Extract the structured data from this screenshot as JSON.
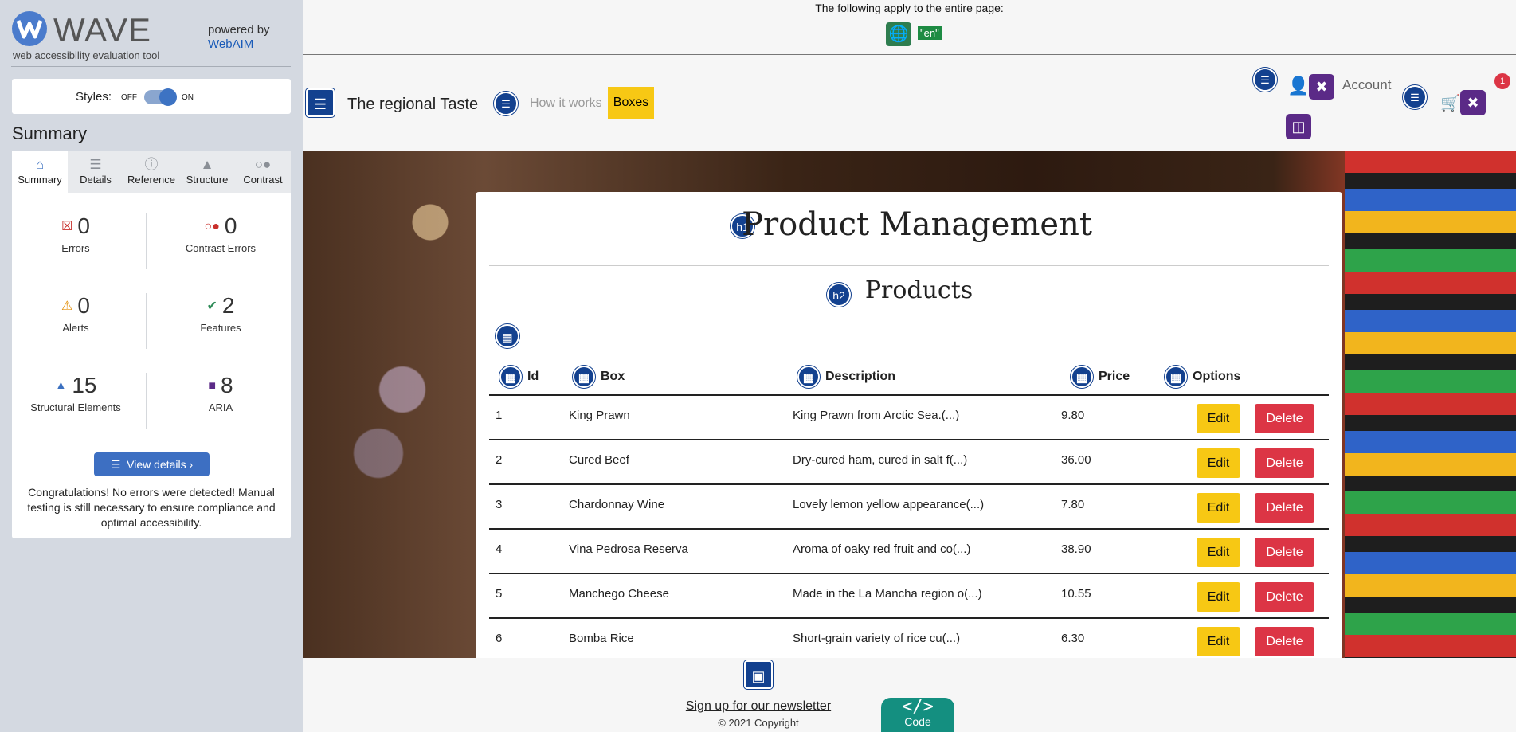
{
  "wave": {
    "title": "WAVE",
    "tagline": "web accessibility evaluation tool",
    "powered_by": "powered by",
    "webaim_link": "WebAIM",
    "styles_label": "Styles:",
    "styles_off": "OFF",
    "styles_on": "ON",
    "summary_heading": "Summary",
    "tabs": [
      {
        "label": "Summary",
        "icon": "home-icon"
      },
      {
        "label": "Details",
        "icon": "list-icon"
      },
      {
        "label": "Reference",
        "icon": "info-icon"
      },
      {
        "label": "Structure",
        "icon": "hierarchy-icon"
      },
      {
        "label": "Contrast",
        "icon": "contrast-icon"
      }
    ],
    "stats": {
      "errors": {
        "count": "0",
        "label": "Errors"
      },
      "contrast_errors": {
        "count": "0",
        "label": "Contrast Errors"
      },
      "alerts": {
        "count": "0",
        "label": "Alerts"
      },
      "features": {
        "count": "2",
        "label": "Features"
      },
      "structural": {
        "count": "15",
        "label": "Structural Elements"
      },
      "aria": {
        "count": "8",
        "label": "ARIA"
      }
    },
    "view_details": "View details ›",
    "congrats": "Congratulations! No errors were detected! Manual testing is still necessary to ensure compliance and optimal accessibility."
  },
  "page_note": {
    "text": "The following apply to the entire page:",
    "lang": "\"en\""
  },
  "header": {
    "brand": "The regional Taste",
    "nav_how": "How it works",
    "nav_boxes": "Boxes",
    "account": "Account",
    "cart_count": "1"
  },
  "main": {
    "h1_badge": "h1",
    "title": "Product Management",
    "h2_badge": "h2",
    "subtitle": "Products",
    "columns": [
      "Id",
      "Box",
      "Description",
      "Price",
      "Options"
    ],
    "edit_label": "Edit",
    "delete_label": "Delete",
    "rows": [
      {
        "id": "1",
        "box": "King Prawn",
        "description": "King Prawn from Arctic Sea.(...)",
        "price": "9.80"
      },
      {
        "id": "2",
        "box": "Cured Beef",
        "description": "Dry-cured ham, cured in salt f(...)",
        "price": "36.00"
      },
      {
        "id": "3",
        "box": "Chardonnay Wine",
        "description": "Lovely lemon yellow appearance(...)",
        "price": "7.80"
      },
      {
        "id": "4",
        "box": "Vina Pedrosa Reserva",
        "description": "Aroma of oaky red fruit and co(...)",
        "price": "38.90"
      },
      {
        "id": "5",
        "box": "Manchego Cheese",
        "description": "Made in the La Mancha region o(...)",
        "price": "10.55"
      },
      {
        "id": "6",
        "box": "Bomba Rice",
        "description": "Short-grain variety of rice cu(...)",
        "price": "6.30"
      }
    ]
  },
  "footer": {
    "newsletter": "Sign up for our newsletter",
    "copyright": "© 2021 Copyright",
    "code_label": "Code",
    "code_symbol": "</>"
  }
}
